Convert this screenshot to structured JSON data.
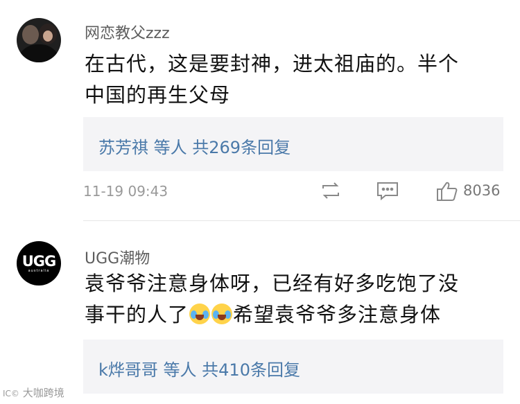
{
  "comments": [
    {
      "username": "网恋教父zzz",
      "avatar_icon": "user-photo-avatar",
      "text_line1": "在古代，这是要封神，进太祖庙的。半个",
      "text_line2": "中国的再生父母",
      "reply_summary": "苏芳祺 等人  共269条回复",
      "timestamp": "11-19 09:43",
      "like_count": "8036"
    },
    {
      "username": "UGG潮物",
      "avatar_logo": "UGG",
      "avatar_logo_sub": "australia",
      "text_line1": "袁爷爷注意身体呀，已经有好多吃饱了没",
      "text_line2_a": "事干的人了",
      "text_line2_b": "希望袁爷爷多注意身体",
      "emoji_icon": "crying-laughing-emoji",
      "reply_summary": "k烨哥哥 等人  共410条回复"
    }
  ],
  "watermark": {
    "logo": "IC©",
    "text": "大咖跨境"
  },
  "colors": {
    "link_blue": "#4a79a9",
    "reply_bg": "#f4f4f6",
    "muted_gray": "#999999"
  }
}
